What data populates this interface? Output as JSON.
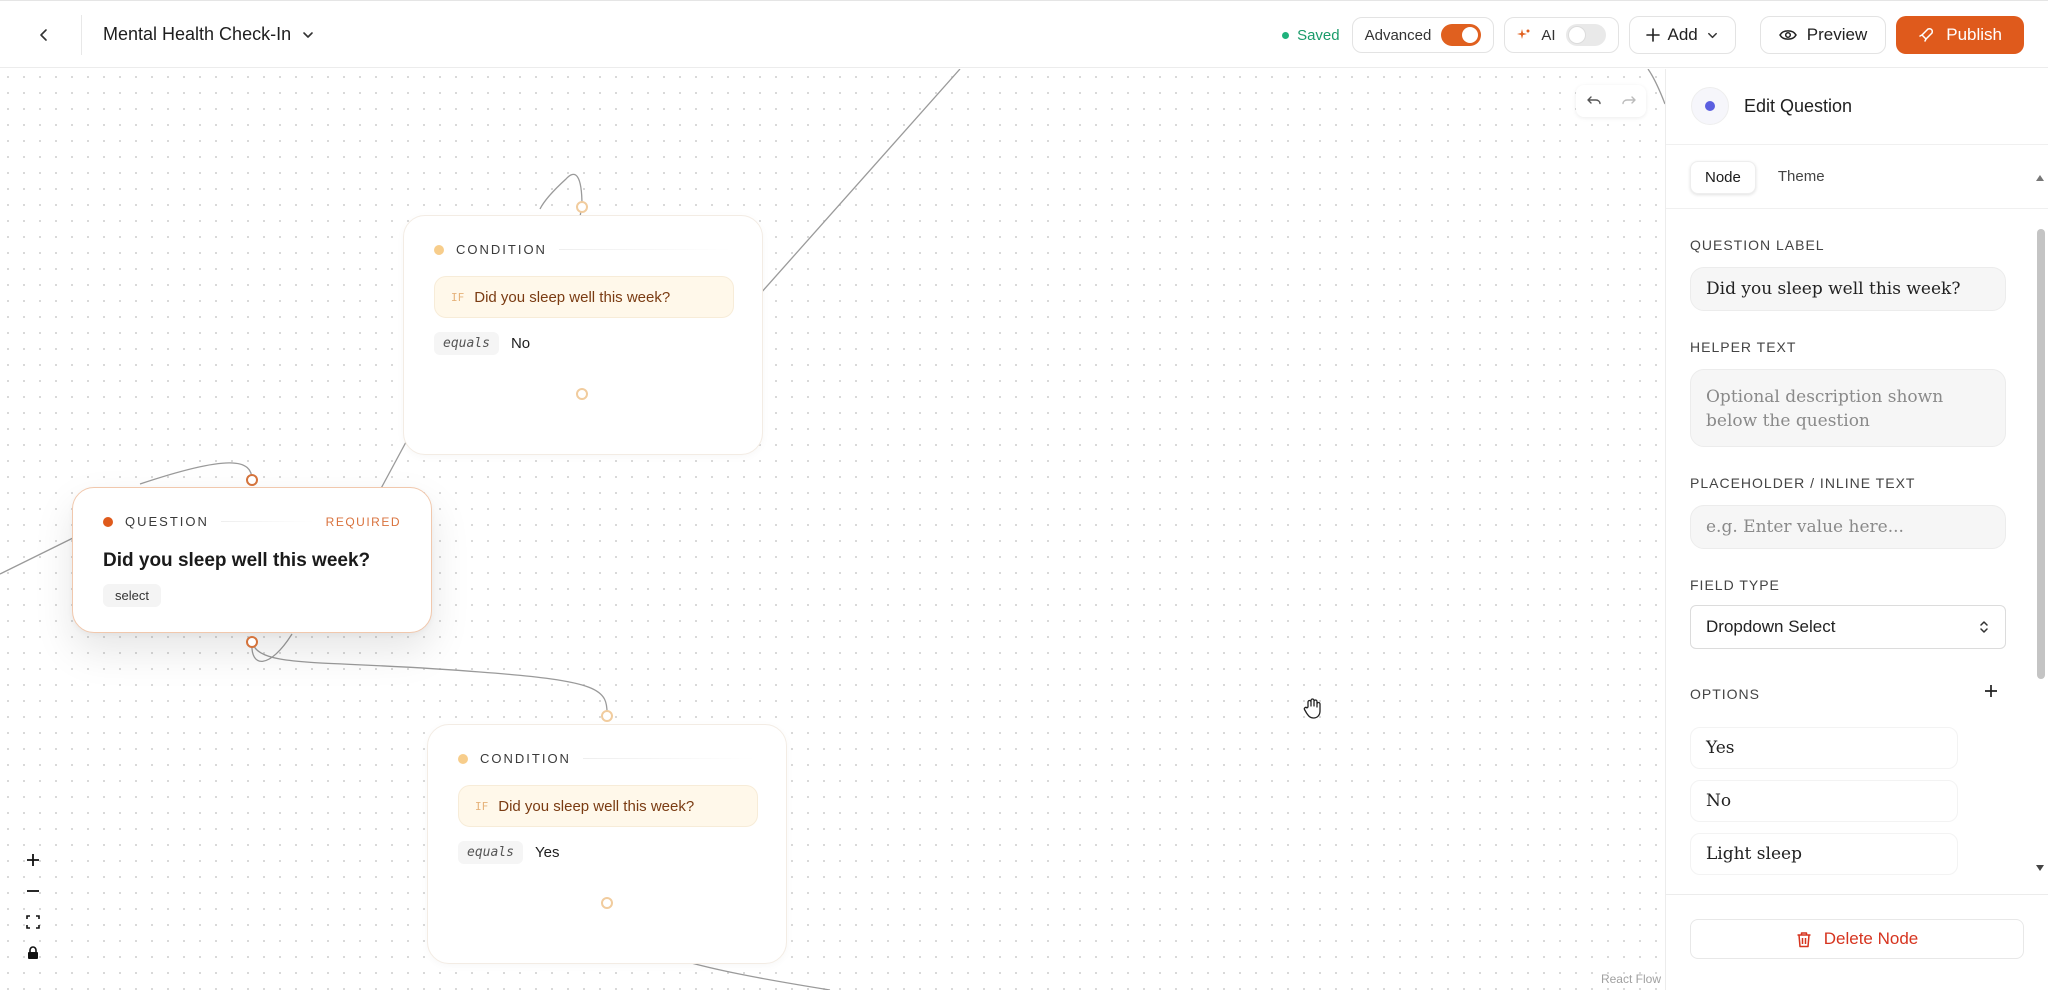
{
  "header": {
    "back_icon": "chevron-left-icon",
    "form_title": "Mental Health Check-In",
    "saved_label": "Saved",
    "advanced_label": "Advanced",
    "advanced_on": true,
    "ai_label": "AI",
    "ai_on": false,
    "add_label": "Add",
    "preview_label": "Preview",
    "publish_label": "Publish",
    "colors": {
      "accent": "#df5a1c",
      "saved": "#1a9b6a"
    }
  },
  "canvas": {
    "nodes": {
      "condition_top": {
        "kind": "CONDITION",
        "if_tag": "IF",
        "if_text": "Did you sleep well this week?",
        "operator": "equals",
        "value": "No"
      },
      "question": {
        "kind": "QUESTION",
        "required": "REQUIRED",
        "title": "Did you sleep well this week?",
        "type": "select"
      },
      "condition_bottom": {
        "kind": "CONDITION",
        "if_tag": "IF",
        "if_text": "Did you sleep well this week?",
        "operator": "equals",
        "value": "Yes"
      }
    },
    "attribution": "React Flow",
    "controls": [
      "zoom-in",
      "zoom-out",
      "fit-view",
      "lock"
    ]
  },
  "panel": {
    "title": "Edit Question",
    "tabs": [
      {
        "label": "Node",
        "active": true
      },
      {
        "label": "Theme",
        "active": false
      }
    ],
    "question_label": {
      "label": "QUESTION LABEL",
      "value": "Did you sleep well this week?"
    },
    "helper_text": {
      "label": "HELPER TEXT",
      "placeholder": "Optional description shown below the question"
    },
    "placeholder_text": {
      "label": "PLACEHOLDER / INLINE TEXT",
      "placeholder": "e.g. Enter value here..."
    },
    "field_type": {
      "label": "FIELD TYPE",
      "value": "Dropdown Select"
    },
    "options": {
      "label": "OPTIONS",
      "items": [
        "Yes",
        "No",
        "Light sleep"
      ]
    },
    "delete_label": "Delete Node"
  }
}
